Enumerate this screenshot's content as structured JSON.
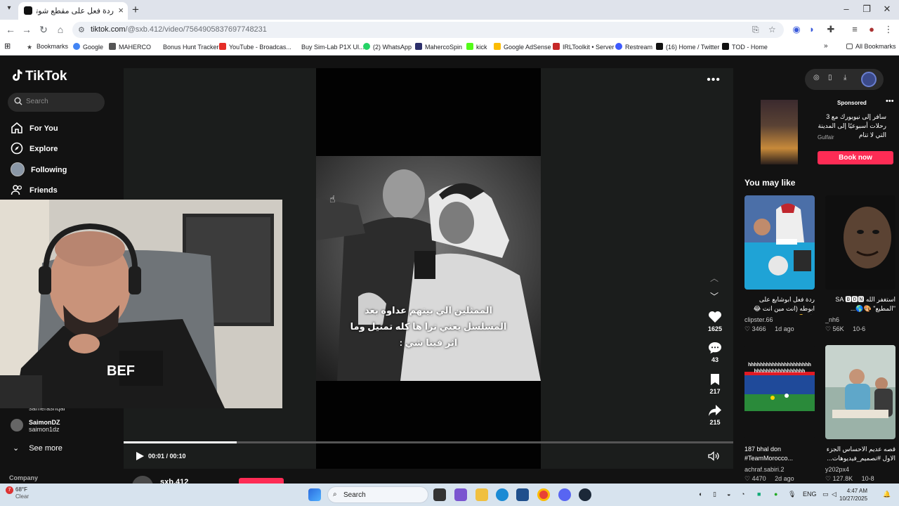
{
  "browser": {
    "tab_title": "ردة فعل على مقطع شوتق الجدد",
    "url_host": "tiktok.com",
    "url_path": "/@sxb.412/video/7564905837697748231",
    "bookmarks": [
      "Bookmarks",
      "Google",
      "MAHERCO",
      "Bonus Hunt Tracker",
      "YouTube - Broadcas...",
      "Buy Sim-Lab P1X Ul...",
      "(2) WhatsApp",
      "MahercoSpin",
      "kick",
      "Google AdSense",
      "IRLToolkit • Server",
      "Restream",
      "(16) Home / Twitter",
      "TOD - Home"
    ],
    "all_bookmarks": "All Bookmarks",
    "chevron_more": "»"
  },
  "tiktok": {
    "logo": "TikTok",
    "search_placeholder": "Search",
    "nav": {
      "for_you": "For You",
      "explore": "Explore",
      "following": "Following",
      "friends": "Friends"
    },
    "following_list": [
      {
        "name": "",
        "handle": "samerashqar"
      },
      {
        "name": "SaimonDZ",
        "handle": "saimon1dz"
      }
    ],
    "see_more": "See more",
    "company": "Company"
  },
  "player": {
    "caption_lines": [
      "الممثلين الي بينهم عداوه بعد",
      "المسلسل يعني ترا ها كله تمثيل وما",
      "اثر فينا شي :"
    ],
    "likes": "1625",
    "comments": "43",
    "saves": "217",
    "shares": "215",
    "time": "00:01 / 00:10",
    "progress": 0.185,
    "author": "sxb.412"
  },
  "ad": {
    "sponsored": "Sponsored",
    "text": "سافر إلى نيويورك مع 3 رحلات أسبوعيًا إلى المدينة التي لا تنام",
    "brand": "Gulfair",
    "cta": "Book now"
  },
  "you_may_like": {
    "heading": "You may like",
    "cards": [
      {
        "title": "ردة فعل ابوشايع على ابوطه (انت مين انت 😂😂)🤣...",
        "user": "clipster.66",
        "likes": "3466",
        "age": "1d ago"
      },
      {
        "title": "ًاستغفر الله ‎SA 🅱🅳🅽 \"المطيع\" ‎🎨🌎...",
        "user": "_nh6",
        "likes": "56K",
        "age": "10-6"
      },
      {
        "title": "187 bhal don #TeamMorocco...",
        "user": "achraf.sabiri.2",
        "likes": "4470",
        "age": "2d ago"
      },
      {
        "title": "قصه عديم الاحساس الجزء الاول #تصميم_فيديوهات...",
        "user": "y202px4",
        "likes": "127.8K",
        "age": "10-8"
      }
    ],
    "card3_overlay": "hhhhhhhhhhhhhhhhhhhhhhhhhhhhhhhhhhhhhh"
  },
  "taskbar": {
    "temp": "68°F",
    "condition": "Clear",
    "weather_badge": "7",
    "search": "Search",
    "lang": "ENG",
    "time": "4:47 AM",
    "date": "10/27/2025"
  },
  "colors": {
    "accent": "#fe2c55",
    "page_bg": "#121212"
  }
}
